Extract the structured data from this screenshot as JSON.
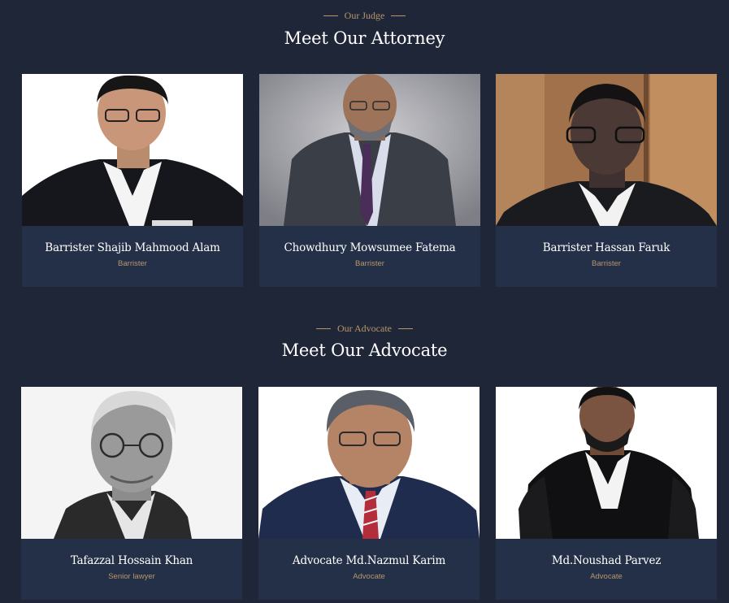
{
  "attorney_section": {
    "eyebrow": "Our Judge",
    "title": "Meet Our Attorney",
    "members": [
      {
        "name": "Barrister Shajib Mahmood Alam",
        "role": "Barrister"
      },
      {
        "name": "Chowdhury Mowsumee Fatema",
        "role": "Barrister"
      },
      {
        "name": "Barrister Hassan Faruk",
        "role": "Barrister"
      }
    ]
  },
  "advocate_section": {
    "eyebrow": "Our Advocate",
    "title": "Meet Our Advocate",
    "members": [
      {
        "name": "Tafazzal Hossain Khan",
        "role": "Senior lawyer"
      },
      {
        "name": "Advocate Md.Nazmul Karim",
        "role": "Advocate"
      },
      {
        "name": "Md.Noushad Parvez",
        "role": "Advocate"
      }
    ]
  },
  "colors": {
    "background": "#1e2638",
    "card": "#243047",
    "accent": "#b9966a",
    "text": "#ffffff"
  }
}
